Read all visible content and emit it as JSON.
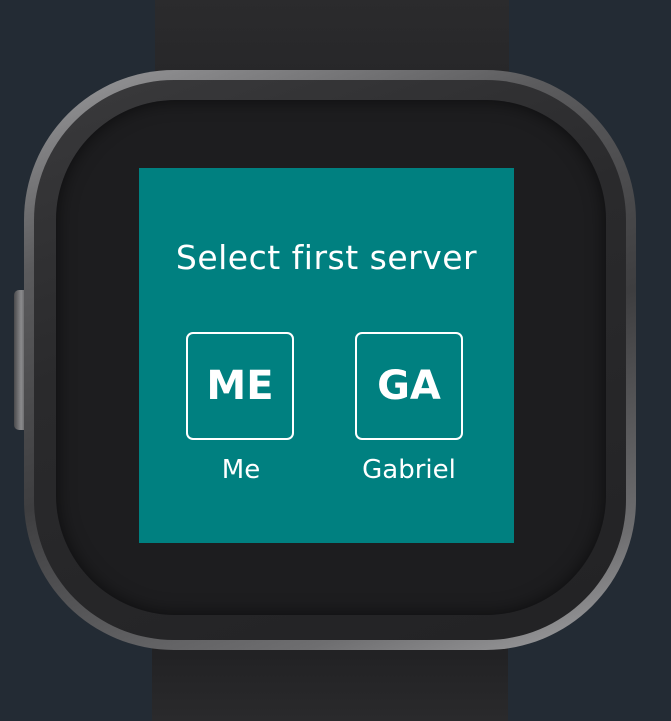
{
  "screen": {
    "background": "#008080",
    "title": "Select first server"
  },
  "options": [
    {
      "initials": "ME",
      "name": "Me"
    },
    {
      "initials": "GA",
      "name": "Gabriel"
    }
  ],
  "device": {
    "type": "smartwatch",
    "background": "#232b34"
  }
}
